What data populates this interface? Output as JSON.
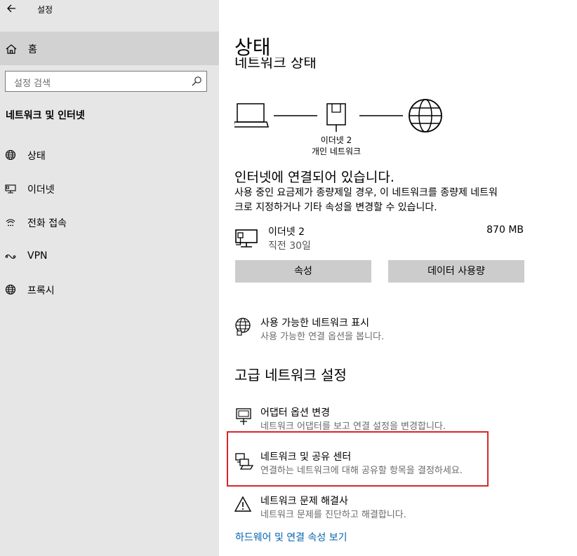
{
  "window": {
    "title": "설정"
  },
  "sidebar": {
    "home_label": "홈",
    "search_placeholder": "설정 검색",
    "section_title": "네트워크 및 인터넷",
    "items": [
      {
        "label": "상태",
        "icon": "globe-icon"
      },
      {
        "label": "이더넷",
        "icon": "ethernet-monitor-icon"
      },
      {
        "label": "전화 접속",
        "icon": "dialup-icon"
      },
      {
        "label": "VPN",
        "icon": "vpn-icon"
      },
      {
        "label": "프록시",
        "icon": "globe-icon"
      }
    ]
  },
  "main": {
    "title": "상태",
    "clipped_heading": "네트워크 상태",
    "diagram": {
      "adapter_name": "이더넷 2",
      "network_type": "개인 네트워크"
    },
    "connection_status": "인터넷에 연결되어 있습니다.",
    "description_line1": "사용 중인 요금제가 종량제일 경우, 이 네트워크를 종량제 네트워",
    "description_line2": "크로 지정하거나 기타 속성을 변경할 수 있습니다.",
    "network": {
      "name": "이더넷 2",
      "time": "직전 30일",
      "usage": "870 MB"
    },
    "buttons": {
      "properties": "속성",
      "data_usage": "데이터 사용량"
    },
    "show_networks": {
      "title": "사용 가능한 네트워크 표시",
      "subtitle": "사용 가능한 연결 옵션을 봅니다."
    },
    "advanced_heading": "고급 네트워크 설정",
    "adapter_options": {
      "title": "어댑터 옵션 변경",
      "subtitle": "네트워크 어댑터를 보고 연결 설정을 변경합니다."
    },
    "sharing_center": {
      "title": "네트워크 및 공유 센터",
      "subtitle": "연결하는 네트워크에 대해 공유할 항목을 결정하세요."
    },
    "troubleshooter": {
      "title": "네트워크 문제 해결사",
      "subtitle": "네트워크 문제를 진단하고 해결합니다."
    },
    "hardware_link": "하드웨어 및 연결 속성 보기"
  },
  "colors": {
    "sidebar_bg": "#e6e6e6",
    "selected_bg": "#d2d2d2",
    "button_bg": "#cccccc",
    "link": "#0063b1",
    "highlight": "#d9262c"
  }
}
